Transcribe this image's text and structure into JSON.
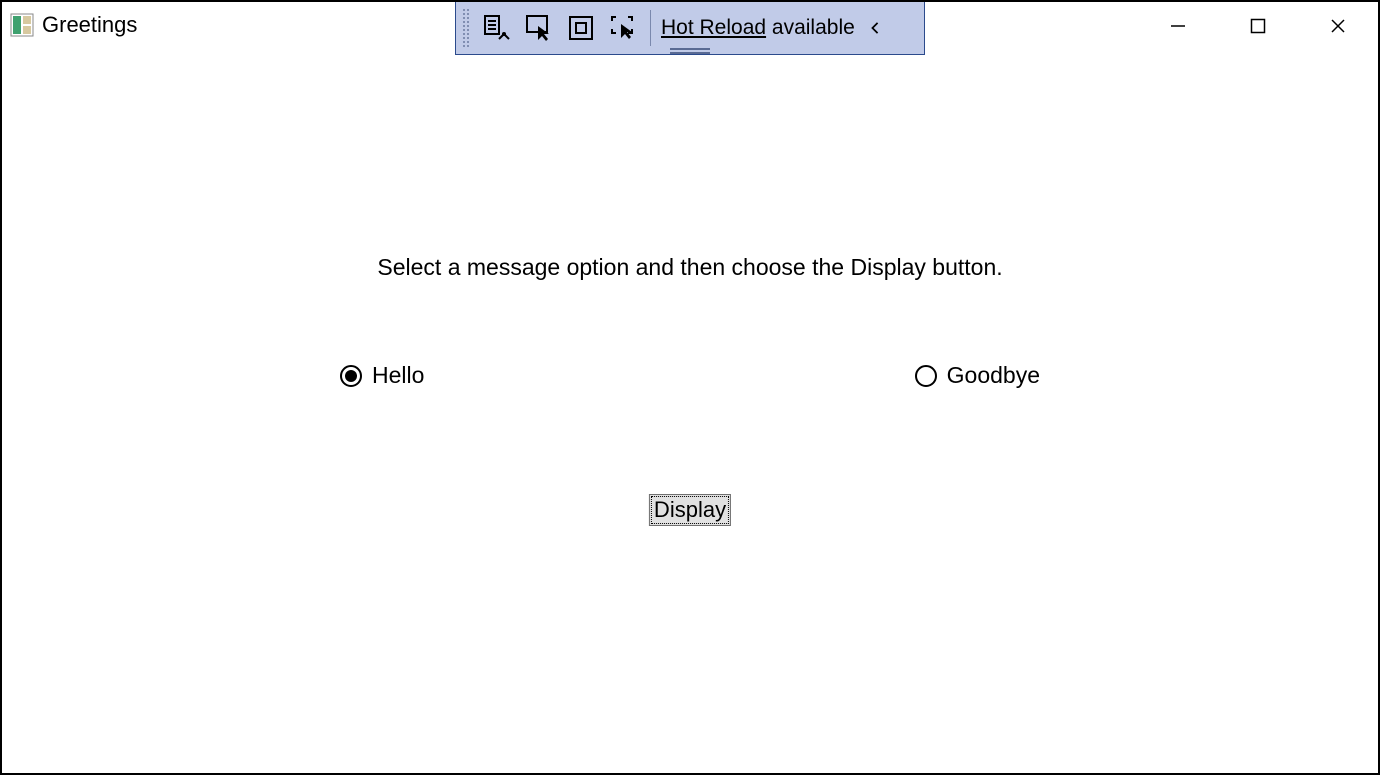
{
  "window": {
    "title": "Greetings"
  },
  "debug_toolbar": {
    "hot_reload_underlined": "Hot Reload",
    "hot_reload_rest": " available",
    "icons": [
      "visual-tree-icon",
      "selection-icon",
      "layout-adorners-icon",
      "track-focus-icon"
    ]
  },
  "content": {
    "instruction": "Select a message option and then choose the Display button.",
    "options": {
      "hello": {
        "label": "Hello",
        "checked": true
      },
      "goodbye": {
        "label": "Goodbye",
        "checked": false
      }
    },
    "display_button": "Display"
  }
}
